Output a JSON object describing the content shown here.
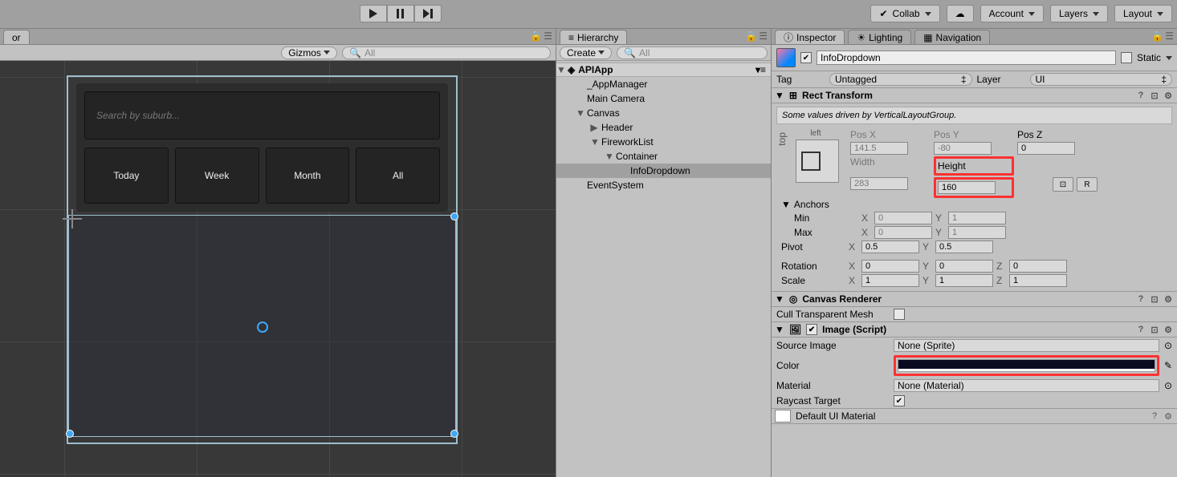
{
  "toolbar": {
    "collab": "Collab",
    "account": "Account",
    "layers": "Layers",
    "layout": "Layout"
  },
  "scene": {
    "tab": "or",
    "gizmos": "Gizmos",
    "search_placeholder": "All",
    "preview": {
      "search_placeholder": "Search by suburb...",
      "tabs": [
        "Today",
        "Week",
        "Month",
        "All"
      ]
    }
  },
  "hierarchy": {
    "title": "Hierarchy",
    "create": "Create",
    "search_placeholder": "All",
    "scene_name": "APIApp",
    "items": [
      {
        "name": "_AppManager",
        "depth": 1,
        "tog": ""
      },
      {
        "name": "Main Camera",
        "depth": 1,
        "tog": ""
      },
      {
        "name": "Canvas",
        "depth": 1,
        "tog": "▼"
      },
      {
        "name": "Header",
        "depth": 2,
        "tog": "▶"
      },
      {
        "name": "FireworkList",
        "depth": 2,
        "tog": "▼"
      },
      {
        "name": "Container",
        "depth": 3,
        "tog": "▼"
      },
      {
        "name": "InfoDropdown",
        "depth": 4,
        "tog": "",
        "sel": true
      },
      {
        "name": "EventSystem",
        "depth": 1,
        "tog": ""
      }
    ]
  },
  "inspector": {
    "tab1": "Inspector",
    "tab2": "Lighting",
    "tab3": "Navigation",
    "object_name": "InfoDropdown",
    "static": "Static",
    "tag_lbl": "Tag",
    "tag_val": "Untagged",
    "layer_lbl": "Layer",
    "layer_val": "UI",
    "rect": {
      "title": "Rect Transform",
      "note": "Some values driven by VerticalLayoutGroup.",
      "anchor_h": "left",
      "anchor_v": "top",
      "posx_lbl": "Pos X",
      "posy_lbl": "Pos Y",
      "posz_lbl": "Pos Z",
      "posx": "141.5",
      "posy": "-80",
      "posz": "0",
      "width_lbl": "Width",
      "height_lbl": "Height",
      "width": "283",
      "height": "160",
      "r_btn": "R",
      "anchors": "Anchors",
      "min": "Min",
      "max": "Max",
      "min_x": "0",
      "min_y": "1",
      "max_x": "0",
      "max_y": "1",
      "pivot": "Pivot",
      "pivot_x": "0.5",
      "pivot_y": "0.5",
      "rotation": "Rotation",
      "rot_x": "0",
      "rot_y": "0",
      "rot_z": "0",
      "scale": "Scale",
      "scl_x": "1",
      "scl_y": "1",
      "scl_z": "1"
    },
    "canvas_renderer": {
      "title": "Canvas Renderer",
      "cull": "Cull Transparent Mesh"
    },
    "image": {
      "title": "Image (Script)",
      "source": "Source Image",
      "source_val": "None (Sprite)",
      "color": "Color",
      "material": "Material",
      "material_val": "None (Material)",
      "raycast": "Raycast Target"
    },
    "default_mat": "Default UI Material"
  }
}
